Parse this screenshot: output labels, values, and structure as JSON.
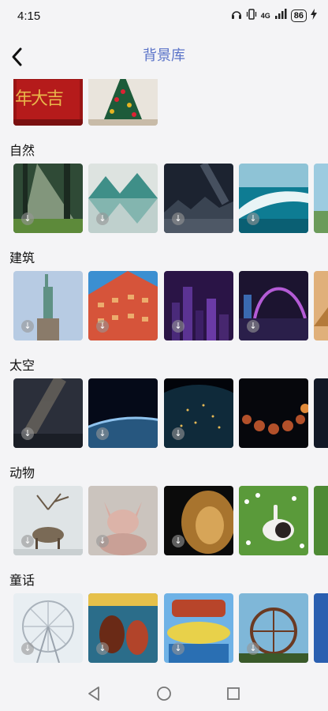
{
  "status_bar": {
    "time": "4:15",
    "network": "4G",
    "battery": "86"
  },
  "header": {
    "title": "背景库"
  },
  "sections": [
    {
      "label": "自然"
    },
    {
      "label": "建筑"
    },
    {
      "label": "太空"
    },
    {
      "label": "动物"
    },
    {
      "label": "童话"
    }
  ],
  "top_row_partial": {
    "caption": "年大吉"
  },
  "colors": {
    "title": "#5a73c8",
    "background": "#f4f4f6"
  },
  "download_icon": "↓"
}
